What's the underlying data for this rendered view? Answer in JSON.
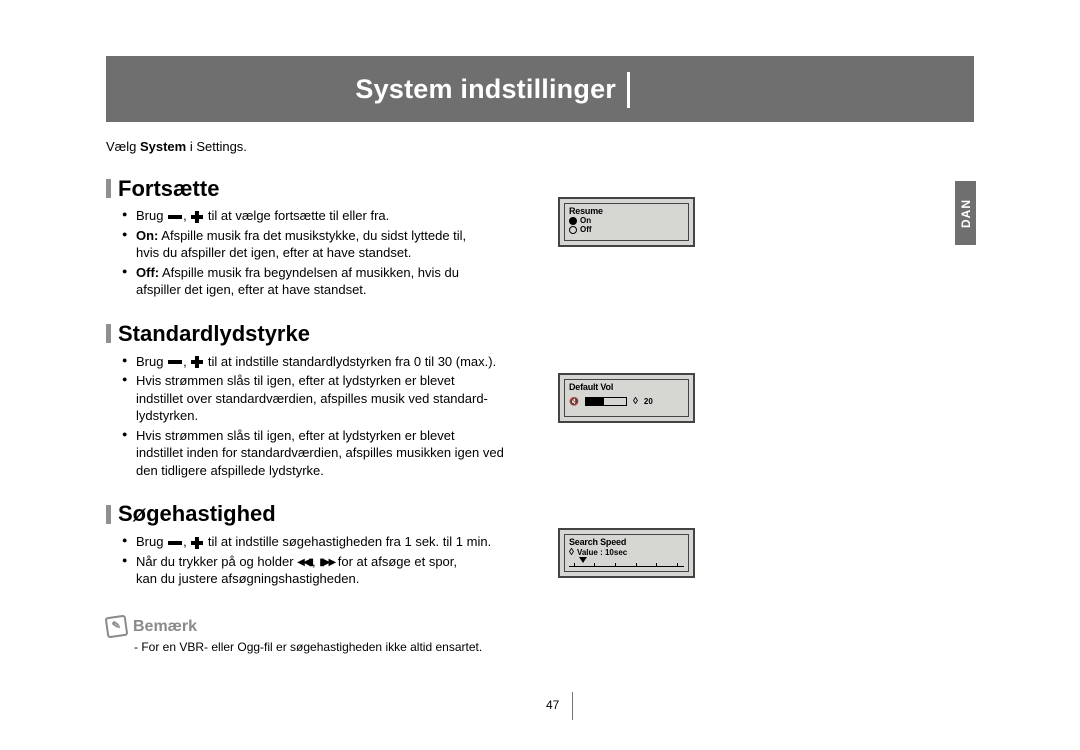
{
  "header": {
    "title": "System indstillinger"
  },
  "langTab": "DAN",
  "intro": {
    "pre": "Vælg ",
    "bold": "System",
    "post": " i Settings."
  },
  "sections": {
    "resume": {
      "title": "Fortsætte",
      "b1_pre": "Brug ",
      "b1_post": " til at vælge fortsætte til eller fra.",
      "b2_label": "On:",
      "b2_text1": " Afspille musik fra det musikstykke, du sidst lyttede til,",
      "b2_text2": "hvis du afspiller det igen, efter at have standset.",
      "b3_label": "Off:",
      "b3_text1": " Afspille musik fra begyndelsen af musikken, hvis du",
      "b3_text2": "afspiller det igen, efter at have standset."
    },
    "defaultVol": {
      "title": "Standardlydstyrke",
      "b1_pre": "Brug ",
      "b1_post": " til at indstille standardlydstyrken fra 0 til 30 (max.).",
      "b2_l1": "Hvis strømmen slås til igen, efter at lydstyrken er blevet",
      "b2_l2": "indstillet over standardværdien, afspilles musik ved standard-",
      "b2_l3": "lydstyrken.",
      "b3_l1": "Hvis strømmen slås til igen, efter at lydstyrken er blevet",
      "b3_l2": "indstillet inden for standardværdien, afspilles musikken igen ved",
      "b3_l3": "den tidligere afspillede lydstyrke."
    },
    "searchSpeed": {
      "title": "Søgehastighed",
      "b1_pre": "Brug ",
      "b1_post": " til at indstille søgehastigheden fra 1 sek. til 1 min.",
      "b2_l1": "Når du trykker på og holder ",
      "b2_l2": " for at afsøge et spor,",
      "b2_l3": "kan du justere afsøgningshastigheden."
    }
  },
  "note": {
    "label": "Bemærk",
    "text": "- For en VBR- eller Ogg-fil er søgehastigheden ikke altid ensartet."
  },
  "lcd": {
    "resume": {
      "title": "Resume",
      "on": "On",
      "off": "Off"
    },
    "defaultVol": {
      "title": "Default Vol",
      "value": "20"
    },
    "searchSpeed": {
      "title": "Search Speed",
      "valueLabel": "Value : 10sec"
    }
  },
  "pageNumber": "47"
}
